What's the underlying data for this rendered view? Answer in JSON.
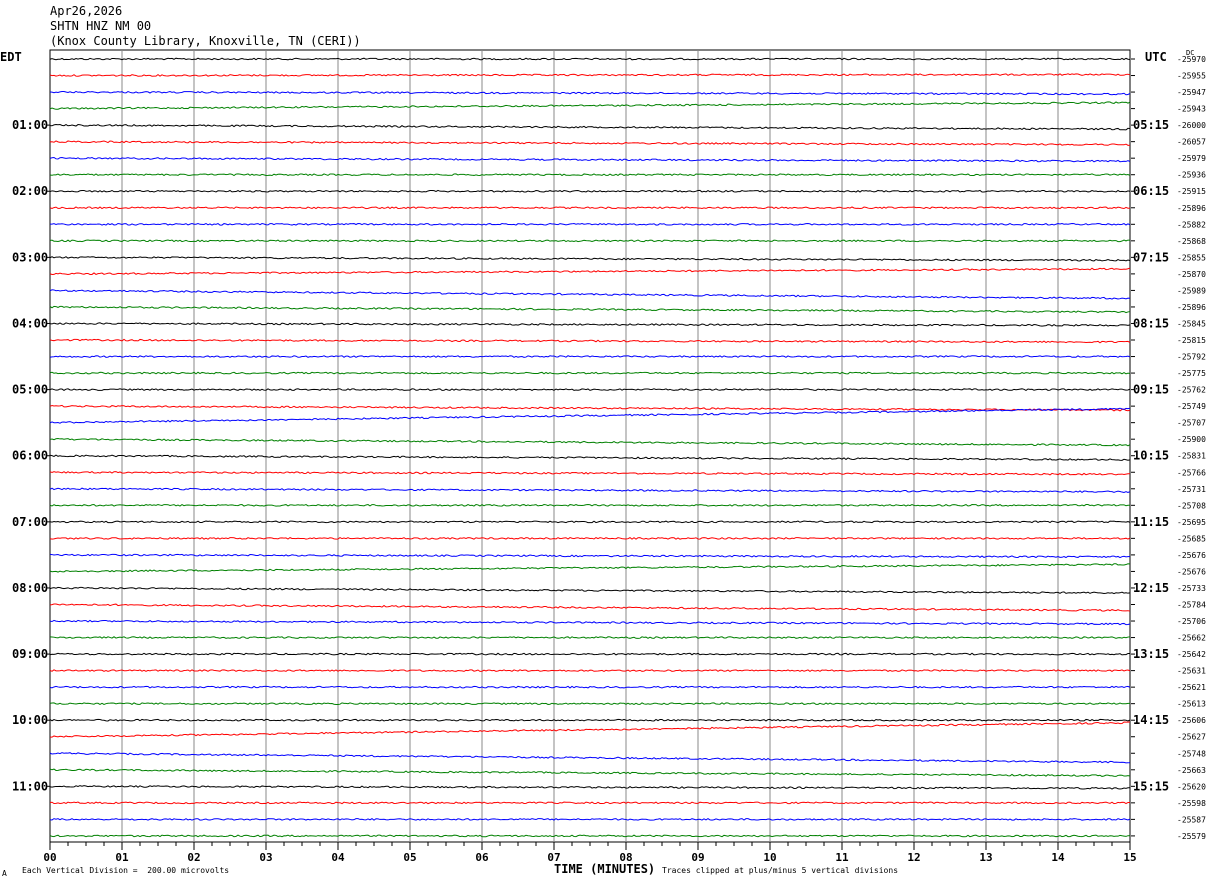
{
  "header": {
    "date": "Apr26,2026",
    "station": "SHTN HNZ NM 00",
    "location": "(Knox County Library, Knoxville, TN (CERI))"
  },
  "timezones": {
    "left": "EDT",
    "right": "UTC",
    "dc_label": "DC"
  },
  "footer": {
    "division": "Each Vertical Division =  200.00 microvolts",
    "xlabel": "TIME (MINUTES)",
    "clip_note": "Traces clipped at plus/minus 5 vertical divisions",
    "corner_mark": "A"
  },
  "colors": {
    "cycle": [
      "#000000",
      "#ff0000",
      "#0000ff",
      "#008000"
    ],
    "grid": "#888888"
  },
  "chart_data": {
    "type": "line",
    "title": "SHTN HNZ NM 00",
    "xlabel": "TIME (MINUTES)",
    "xlim": [
      0,
      15
    ],
    "x_ticks": [
      "00",
      "01",
      "02",
      "03",
      "04",
      "05",
      "06",
      "07",
      "08",
      "09",
      "10",
      "11",
      "12",
      "13",
      "14",
      "15"
    ],
    "row_minutes": 15,
    "left_hour_labels": [
      "01:00",
      "02:00",
      "03:00",
      "04:00",
      "05:00",
      "06:00",
      "07:00",
      "08:00",
      "09:00",
      "10:00",
      "11:00"
    ],
    "right_hour_labels": [
      "05:15",
      "06:15",
      "07:15",
      "08:15",
      "09:15",
      "10:15",
      "11:15",
      "12:15",
      "13:15",
      "14:15",
      "15:15"
    ],
    "dc_offsets": [
      "-25970",
      "-25955",
      "-25947",
      "-25943",
      "-26000",
      "-26057",
      "-25979",
      "-25936",
      "-25915",
      "-25896",
      "-25882",
      "-25868",
      "-25855",
      "-25870",
      "-25989",
      "-25896",
      "-25845",
      "-25815",
      "-25792",
      "-25775",
      "-25762",
      "-25749",
      "-25707",
      "-25900",
      "-25831",
      "-25766",
      "-25731",
      "-25708",
      "-25695",
      "-25685",
      "-25676",
      "-25676",
      "-25733",
      "-25784",
      "-25706",
      "-25662",
      "-25642",
      "-25631",
      "-25621",
      "-25613",
      "-25606",
      "-25627",
      "-25748",
      "-25663",
      "-25620",
      "-25598",
      "-25587",
      "-25579"
    ],
    "drift": {
      "1": -1,
      "2": 2,
      "3": -6,
      "4": 4,
      "5": 3,
      "6": 3,
      "12": 3,
      "13": -5,
      "14": 8,
      "15": 5,
      "16": 2,
      "17": 2,
      "21": 4,
      "22": -14,
      "23": 6,
      "24": 4,
      "25": 2,
      "26": 3,
      "30": 2,
      "31": -7,
      "32": 5,
      "33": 6,
      "34": 3,
      "41": -14,
      "42": 9,
      "43": 6,
      "44": 2
    }
  }
}
